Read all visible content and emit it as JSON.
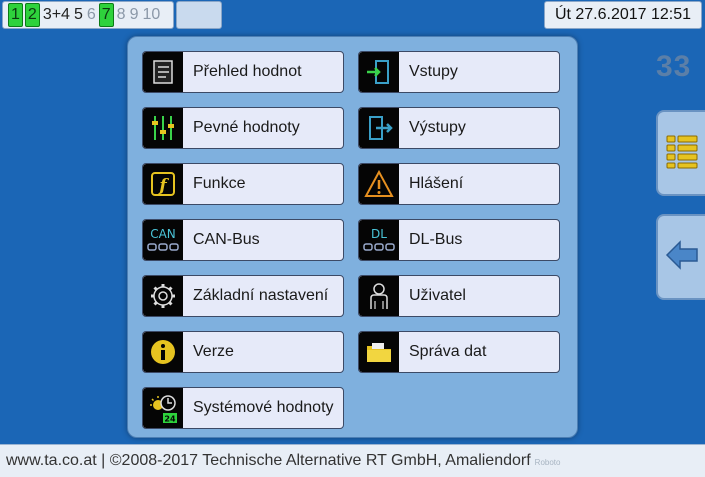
{
  "header": {
    "nodes": [
      {
        "label": "1",
        "state": "active"
      },
      {
        "label": "2",
        "state": "active"
      },
      {
        "label": "3+4",
        "state": "normal"
      },
      {
        "label": "5",
        "state": "normal"
      },
      {
        "label": "6",
        "state": "dim"
      },
      {
        "label": "7",
        "state": "active"
      },
      {
        "label": "8",
        "state": "dim"
      },
      {
        "label": "9",
        "state": "dim"
      },
      {
        "label": "10",
        "state": "dim"
      }
    ],
    "datetime": "Út 27.6.2017 12:51"
  },
  "page_number": "33",
  "menu": {
    "items": [
      {
        "label": "Přehled hodnot",
        "icon": "value-overview-icon"
      },
      {
        "label": "Vstupy",
        "icon": "inputs-icon"
      },
      {
        "label": "Pevné hodnoty",
        "icon": "fixed-values-icon"
      },
      {
        "label": "Výstupy",
        "icon": "outputs-icon"
      },
      {
        "label": "Funkce",
        "icon": "functions-icon"
      },
      {
        "label": "Hlášení",
        "icon": "messages-warning-icon"
      },
      {
        "label": "CAN-Bus",
        "icon": "can-bus-icon",
        "icon_text": "CAN"
      },
      {
        "label": "DL-Bus",
        "icon": "dl-bus-icon",
        "icon_text": "DL"
      },
      {
        "label": "Základní nastavení",
        "icon": "gear-icon"
      },
      {
        "label": "Uživatel",
        "icon": "user-icon"
      },
      {
        "label": "Verze",
        "icon": "info-icon"
      },
      {
        "label": "Správa dat",
        "icon": "folder-icon"
      },
      {
        "label": "Systémové hodnoty",
        "icon": "system-values-icon",
        "icon_text": "24"
      }
    ]
  },
  "side_buttons": {
    "menu_icon": "menu-list-icon",
    "back_icon": "back-arrow-icon"
  },
  "footer": {
    "text": "www.ta.co.at | ©2008-2017 Technische Alternative RT GmbH, Amaliendorf",
    "font_label": "Roboto"
  },
  "colors": {
    "background": "#1b66b6",
    "panel": "#7fb0de",
    "item": "#e6eaf9",
    "node_active": "#2ed23c"
  }
}
